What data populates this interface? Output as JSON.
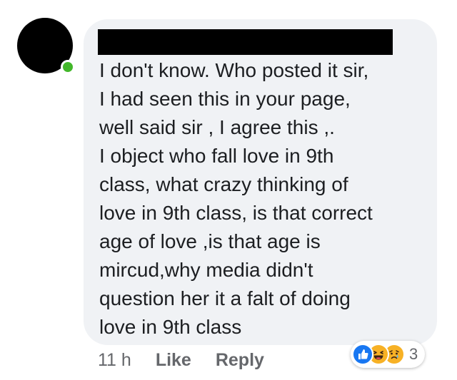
{
  "comment": {
    "author_redacted": true,
    "lines": [
      "I don't know. Who posted it sir,",
      "I had seen this in your page,",
      "well said sir , I agree this ,.",
      "I object who fall love in 9th",
      "class, what crazy thinking of",
      "love in 9th class, is that correct",
      "age of love ,is that age is",
      "mircud,why media didn't",
      "question her it a falt of doing",
      "love in 9th class"
    ]
  },
  "actions": {
    "timestamp": "11 h",
    "like_label": "Like",
    "reply_label": "Reply"
  },
  "reactions": {
    "icons": [
      "like-icon",
      "haha-icon",
      "sad-icon"
    ],
    "count": "3",
    "colors": {
      "like": "#1877f2",
      "emoji": "#f7b125"
    }
  },
  "colors": {
    "bubble_bg": "#f0f2f5",
    "text": "#1c1e21",
    "meta": "#65676b",
    "online": "#42b72a"
  }
}
